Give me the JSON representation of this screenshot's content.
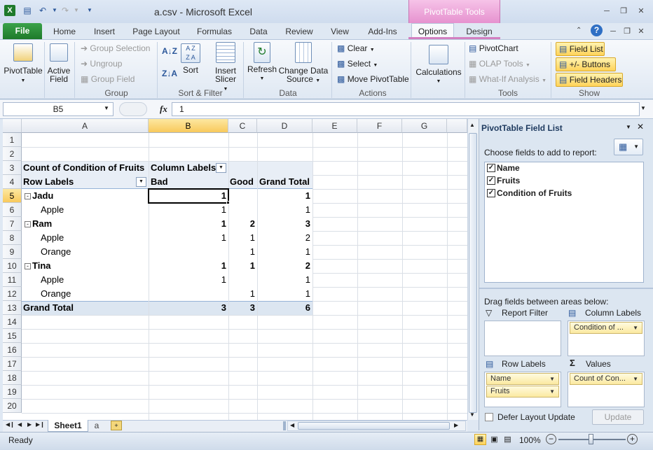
{
  "window": {
    "title": "a.csv - Microsoft Excel",
    "context_tab_header": "PivotTable Tools"
  },
  "tabs": [
    "File",
    "Home",
    "Insert",
    "Page Layout",
    "Formulas",
    "Data",
    "Review",
    "View",
    "Add-Ins",
    "Options",
    "Design"
  ],
  "ribbon": {
    "pivottable": "PivotTable",
    "active_field_line1": "Active",
    "active_field_line2": "Field",
    "group_selection": "Group Selection",
    "ungroup": "Ungroup",
    "group_field": "Group Field",
    "group_label": "Group",
    "sort": "Sort",
    "insert_slicer_line1": "Insert",
    "insert_slicer_line2": "Slicer",
    "sort_filter_label": "Sort & Filter",
    "refresh": "Refresh",
    "change_data_source_line1": "Change Data",
    "change_data_source_line2": "Source",
    "data_label": "Data",
    "clear": "Clear",
    "select": "Select",
    "move_pivottable": "Move PivotTable",
    "actions_label": "Actions",
    "calculations": "Calculations",
    "pivotchart": "PivotChart",
    "olap_tools": "OLAP Tools",
    "what_if": "What-If Analysis",
    "tools_label": "Tools",
    "field_list": "Field List",
    "buttons": "+/- Buttons",
    "field_headers": "Field Headers",
    "show_label": "Show"
  },
  "formula_bar": {
    "name_box": "B5",
    "fx": "fx",
    "value": "1"
  },
  "columns": [
    "A",
    "B",
    "C",
    "D",
    "E",
    "F",
    "G"
  ],
  "rows": [
    "1",
    "2",
    "3",
    "4",
    "5",
    "6",
    "7",
    "8",
    "9",
    "10",
    "11",
    "12",
    "13",
    "14",
    "15",
    "16",
    "17",
    "18",
    "19",
    "20"
  ],
  "pivot": {
    "title": "Count of Condition of Fruits",
    "column_labels": "Column Labels",
    "row_labels": "Row Labels",
    "bad": "Bad",
    "good": "Good",
    "grand_total": "Grand Total",
    "jadu": "Jadu",
    "jadu_bad": "1",
    "jadu_total": "1",
    "jadu_apple": "Apple",
    "jadu_apple_bad": "1",
    "jadu_apple_total": "1",
    "ram": "Ram",
    "ram_bad": "1",
    "ram_good": "2",
    "ram_total": "3",
    "ram_apple": "Apple",
    "ram_apple_bad": "1",
    "ram_apple_good": "1",
    "ram_apple_total": "2",
    "ram_orange": "Orange",
    "ram_orange_good": "1",
    "ram_orange_total": "1",
    "tina": "Tina",
    "tina_bad": "1",
    "tina_good": "1",
    "tina_total": "2",
    "tina_apple": "Apple",
    "tina_apple_bad": "1",
    "tina_apple_total": "1",
    "tina_orange": "Orange",
    "tina_orange_good": "1",
    "tina_orange_total": "1",
    "gt_label": "Grand Total",
    "gt_bad": "3",
    "gt_good": "3",
    "gt_total": "6"
  },
  "sheets": {
    "active": "Sheet1",
    "other": "a"
  },
  "status": {
    "ready": "Ready",
    "zoom": "100%"
  },
  "field_list": {
    "title": "PivotTable Field List",
    "choose": "Choose fields to add to report:",
    "fields": [
      "Name",
      "Fruits",
      "Condition of Fruits"
    ],
    "drag": "Drag fields between areas below:",
    "report_filter": "Report Filter",
    "column_labels": "Column Labels",
    "row_labels": "Row Labels",
    "values": "Values",
    "col_chip": "Condition of ...",
    "row_chip1": "Name",
    "row_chip2": "Fruits",
    "val_chip": "Count of Con...",
    "defer": "Defer Layout Update",
    "update": "Update"
  }
}
